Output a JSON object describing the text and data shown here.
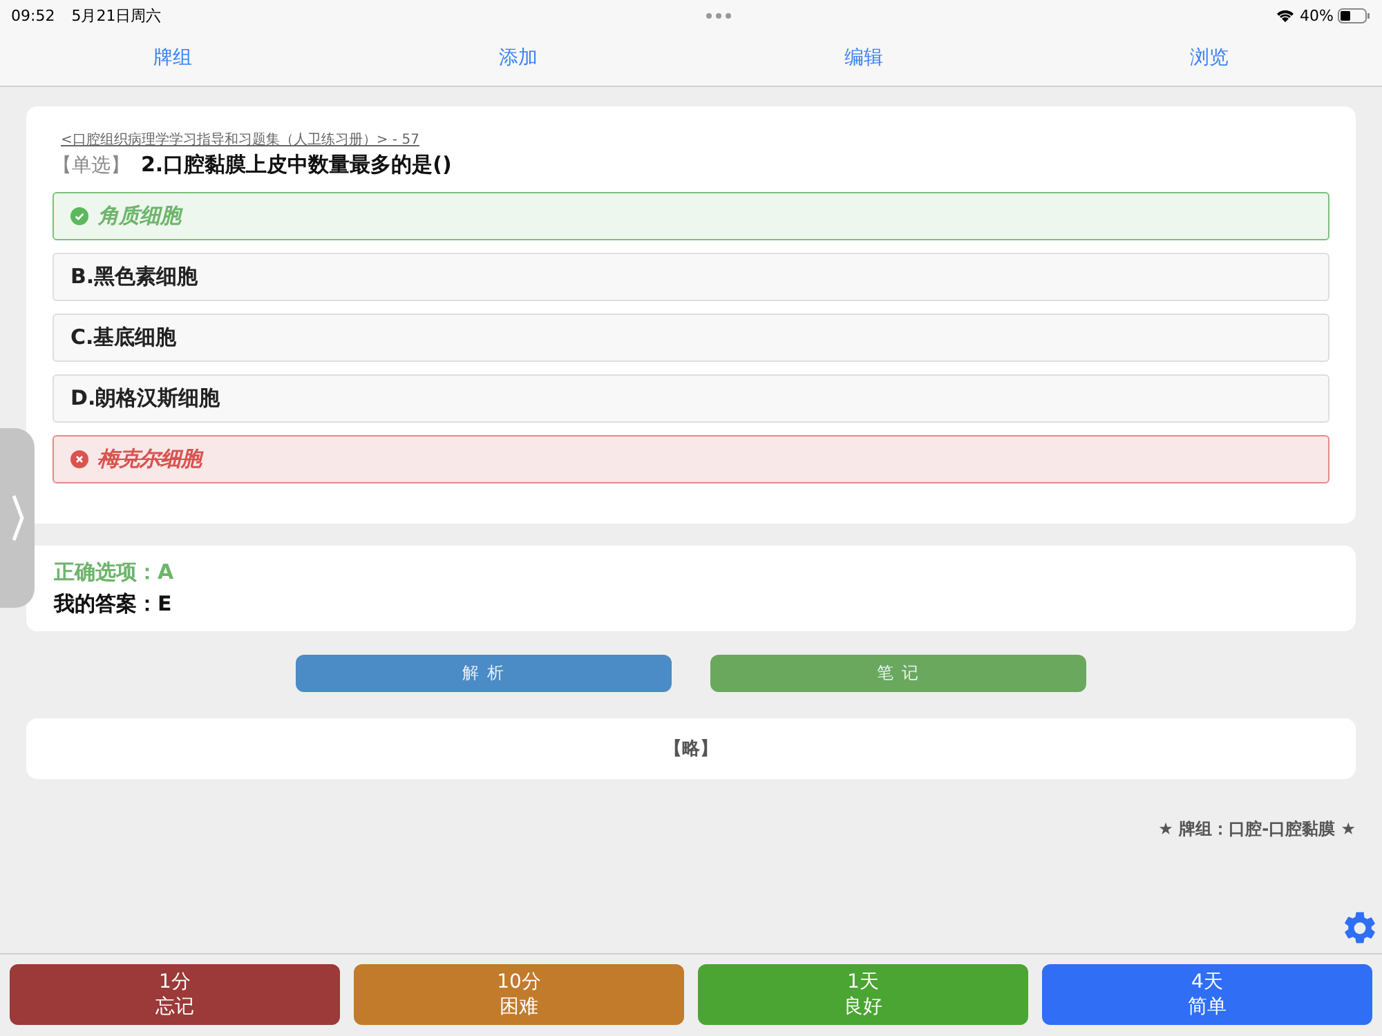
{
  "status_bar": {
    "time": "09:52",
    "date": "5月21日周六",
    "battery": "40%"
  },
  "nav": [
    {
      "label": "牌组"
    },
    {
      "label": "添加"
    },
    {
      "label": "编辑"
    },
    {
      "label": "浏览"
    }
  ],
  "question": {
    "source": "<口腔组织病理学学习指导和习题集（人卫练习册）> - 57",
    "type": "【单选】",
    "text": "2.口腔黏膜上皮中数量最多的是()",
    "options": [
      {
        "kind": "correct",
        "text": "角质细胞"
      },
      {
        "kind": "plain",
        "text": "B.黑色素细胞"
      },
      {
        "kind": "plain",
        "text": "C.基底细胞"
      },
      {
        "kind": "plain",
        "text": "D.朗格汉斯细胞"
      },
      {
        "kind": "wrong",
        "text": "梅克尔细胞"
      }
    ]
  },
  "answer": {
    "correct": "正确选项：A",
    "mine": "我的答案：E"
  },
  "actions": [
    {
      "label": "解 析",
      "color": "#4b8bc6"
    },
    {
      "label": "笔 记",
      "color": "#6aa85e"
    }
  ],
  "explanation": "【略】",
  "deck": "★ 牌组：口腔-口腔黏膜 ★",
  "ratings": [
    {
      "interval": "1分",
      "label": "忘记",
      "color": "#9b3a38"
    },
    {
      "interval": "10分",
      "label": "困难",
      "color": "#c17b2b"
    },
    {
      "interval": "1天",
      "label": "良好",
      "color": "#4aa532"
    },
    {
      "interval": "4天",
      "label": "简单",
      "color": "#2f6ef5"
    }
  ]
}
